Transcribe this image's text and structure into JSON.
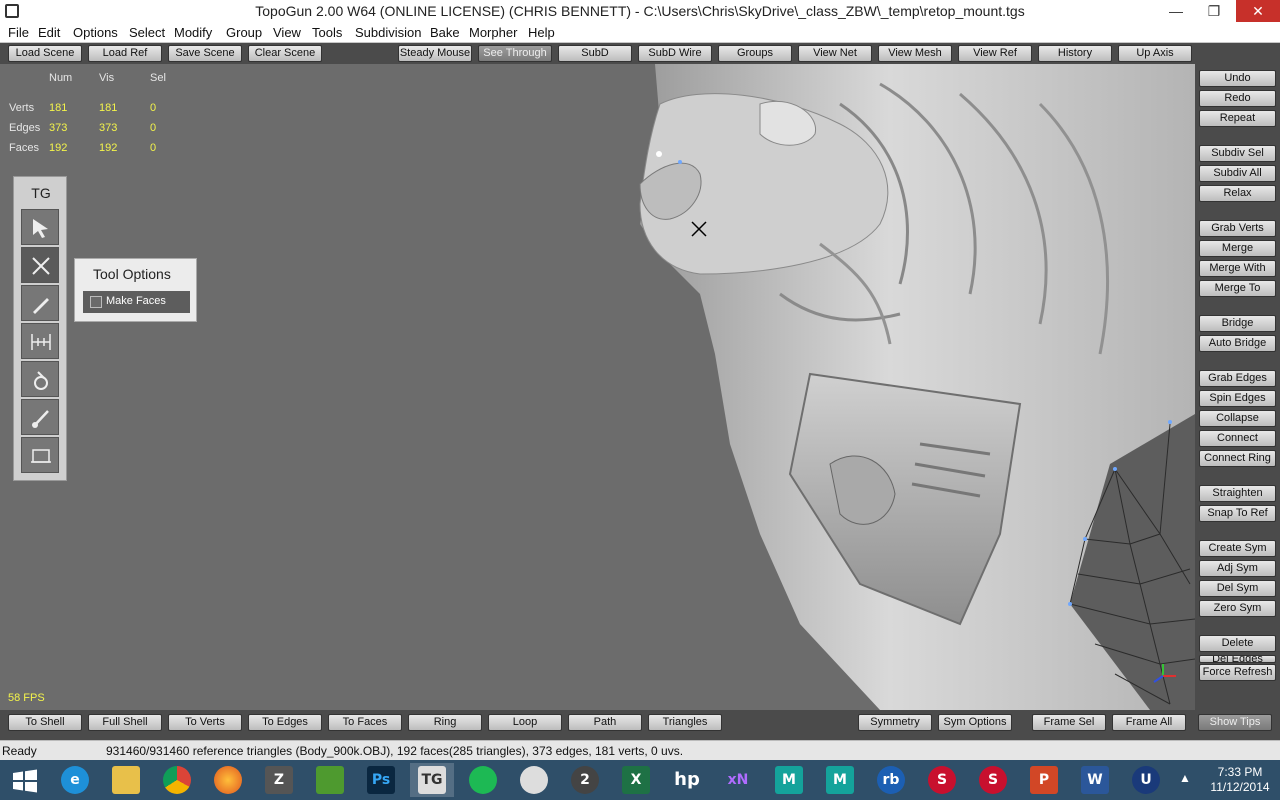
{
  "window": {
    "title": "TopoGun 2.00 W64  (ONLINE LICENSE) (CHRIS BENNETT) - C:\\Users\\Chris\\SkyDrive\\_class_ZBW\\_temp\\retop_mount.tgs",
    "minimize": "—",
    "restore": "❐",
    "close": "✕"
  },
  "menu": [
    "File",
    "Edit",
    "Options",
    "Select",
    "Modify",
    "Group",
    "View",
    "Tools",
    "Subdivision",
    "Bake",
    "Morpher",
    "Help"
  ],
  "top_toolbar": [
    "Load Scene",
    "Load Ref",
    "Save Scene",
    "Clear Scene",
    "Steady Mouse",
    "See Through",
    "SubD",
    "SubD Wire",
    "Groups",
    "View Net",
    "View Mesh",
    "View Ref",
    "History",
    "Up Axis"
  ],
  "active_toggle": "See Through",
  "stats": {
    "headers": [
      "Num",
      "Vis",
      "Sel"
    ],
    "rows": [
      {
        "label": "Verts",
        "num": "181",
        "vis": "181",
        "sel": "0"
      },
      {
        "label": "Edges",
        "num": "373",
        "vis": "373",
        "sel": "0"
      },
      {
        "label": "Faces",
        "num": "192",
        "vis": "192",
        "sel": "0"
      }
    ]
  },
  "fps": "58 FPS",
  "tool_panel": {
    "title": "TG",
    "tools": [
      "select-tool-icon",
      "simple-create-tool-icon",
      "draw-tool-icon",
      "bridge-tool-icon",
      "brush-tool-icon",
      "paint-tool-icon",
      "faces-tool-icon"
    ]
  },
  "tool_options": {
    "title": "Tool Options",
    "make_faces_label": "Make Faces",
    "make_faces_checked": false
  },
  "right_panel": {
    "groups": [
      [
        "Undo",
        "Redo",
        "Repeat"
      ],
      [
        "Subdiv Sel",
        "Subdiv All",
        "Relax"
      ],
      [
        "Grab Verts",
        "Merge",
        "Merge With",
        "Merge To"
      ],
      [
        "Bridge",
        "Auto Bridge"
      ],
      [
        "Grab Edges",
        "Spin Edges",
        "Collapse",
        "Connect",
        "Connect Ring"
      ],
      [
        "Straighten",
        "Snap To Ref"
      ],
      [
        "Create Sym",
        "Adj Sym",
        "Del Sym",
        "Zero Sym"
      ],
      [
        "Delete",
        "Del Edges"
      ],
      [
        "Force Refresh"
      ]
    ]
  },
  "bottom_toolbar": [
    "To Shell",
    "Full Shell",
    "To Verts",
    "To Edges",
    "To Faces",
    "Ring",
    "Loop",
    "Path",
    "Triangles",
    "Symmetry",
    "Sym Options",
    "Frame Sel",
    "Frame All",
    "Show Tips"
  ],
  "status": {
    "ready": "Ready",
    "info": "931460/931460 reference triangles (Body_900k.OBJ), 192 faces(285 triangles), 373 edges, 181 verts, 0 uvs."
  },
  "taskbar": {
    "apps": [
      {
        "icon": "windows-start-icon",
        "label": ""
      },
      {
        "icon": "internet-explorer-icon",
        "label": "e"
      },
      {
        "icon": "file-explorer-icon",
        "label": ""
      },
      {
        "icon": "chrome-icon",
        "label": ""
      },
      {
        "icon": "firefox-icon",
        "label": ""
      },
      {
        "icon": "zbrush-icon",
        "label": "Z"
      },
      {
        "icon": "marmoset-icon",
        "label": ""
      },
      {
        "icon": "photoshop-icon",
        "label": "Ps"
      },
      {
        "icon": "topogun-icon",
        "label": "TG"
      },
      {
        "icon": "spotify-icon",
        "label": ""
      },
      {
        "icon": "unity-icon",
        "label": ""
      },
      {
        "icon": "headus-icon",
        "label": "2"
      },
      {
        "icon": "excel-icon",
        "label": "X"
      },
      {
        "icon": "hp-icon",
        "label": "hp"
      },
      {
        "icon": "xnormal-icon",
        "label": "xN"
      },
      {
        "icon": "maya-lt-icon",
        "label": "M"
      },
      {
        "icon": "maya-icon",
        "label": "M"
      },
      {
        "icon": "rb-icon",
        "label": "rb"
      },
      {
        "icon": "substance-designer-icon",
        "label": "S"
      },
      {
        "icon": "substance-painter-icon",
        "label": "S"
      },
      {
        "icon": "powerpoint-icon",
        "label": "P"
      },
      {
        "icon": "word-icon",
        "label": "W"
      },
      {
        "icon": "unreal-icon",
        "label": "U"
      }
    ],
    "time": "7:33 PM",
    "date": "11/12/2014"
  },
  "colors": {
    "viewport_bg": "#6c6c6c",
    "panel_bg": "#4b4b4b",
    "stat_value": "#f4f44b",
    "taskbar_bg": "#2f4f69",
    "close_button": "#c7302a"
  }
}
